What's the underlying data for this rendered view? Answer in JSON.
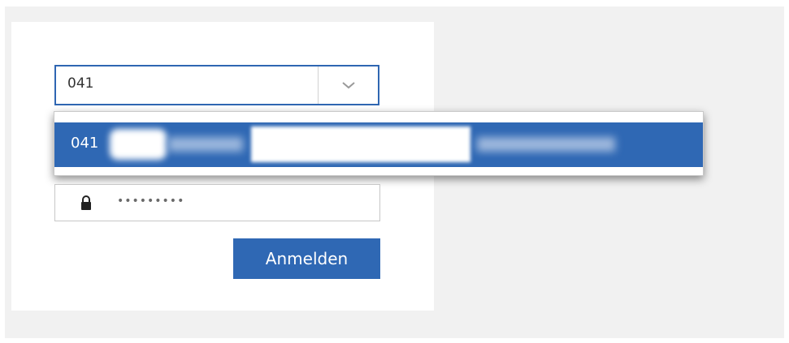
{
  "login": {
    "account_input_value": "041",
    "dropdown_option_text": "041",
    "password_masked": "•••••••••",
    "submit_label": "Anmelden"
  },
  "colors": {
    "accent": "#2f68b4",
    "background": "#f1f1f1",
    "card": "#ffffff"
  },
  "icons": {
    "combo_toggle": "chevron-down-icon",
    "password": "lock-icon"
  }
}
